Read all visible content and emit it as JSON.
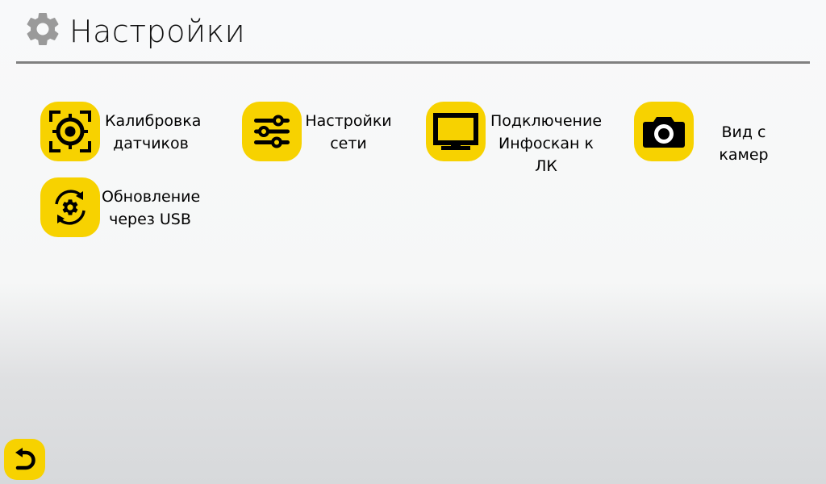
{
  "header": {
    "title": "Настройки",
    "icon": "gear-icon"
  },
  "tiles": [
    {
      "label": "Калибровка\nдатчиков",
      "icon": "target-icon"
    },
    {
      "label": "Настройки\nсети",
      "icon": "sliders-icon"
    },
    {
      "label": "Подключение\nИнфоскан к ЛК",
      "icon": "monitor-icon"
    },
    {
      "label": "Вид с камер",
      "icon": "camera-icon"
    },
    {
      "label": "Обновление\nчерез USB",
      "icon": "gear-refresh-icon"
    }
  ],
  "footer": {
    "back_icon": "back-arrow-icon"
  },
  "colors": {
    "accent": "#f7d200",
    "divider": "#808080",
    "header_icon": "#9a9a9a"
  }
}
